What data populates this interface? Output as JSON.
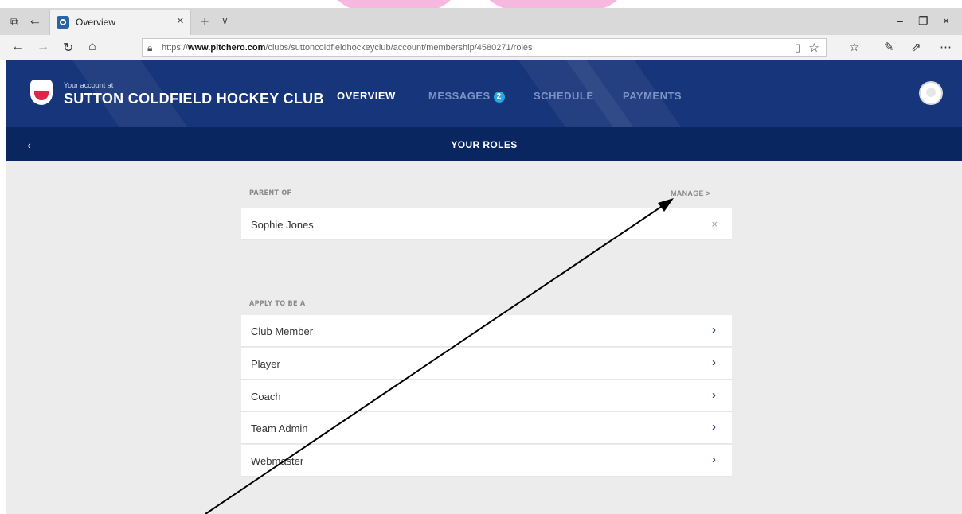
{
  "browser": {
    "tab_title": "Overview",
    "url_prefix": "https://",
    "url_domain": "www.pitchero.com",
    "url_path": "/clubs/suttoncoldfieldhockeyclub/account/membership/4580271/roles"
  },
  "header": {
    "account_caption": "Your account at",
    "club_name": "SUTTON COLDFIELD HOCKEY CLUB",
    "nav": {
      "overview": "OVERVIEW",
      "messages": "MESSAGES",
      "messages_count": "2",
      "schedule": "SCHEDULE",
      "payments": "PAYMENTS"
    }
  },
  "subheader": {
    "title": "YOUR ROLES"
  },
  "parent_section": {
    "label": "PARENT OF",
    "manage": "MANAGE >",
    "children": [
      "Sophie Jones"
    ]
  },
  "apply_section": {
    "label": "APPLY TO BE A",
    "roles": [
      "Club Member",
      "Player",
      "Coach",
      "Team Admin",
      "Webmaster"
    ]
  },
  "colors": {
    "header_blue": "#17357a",
    "subheader_blue": "#0a2661",
    "badge_blue": "#29a8df",
    "annotation_pink": "#f7b8df"
  }
}
